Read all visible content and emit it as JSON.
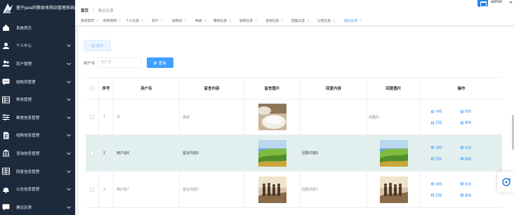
{
  "app": {
    "title": "基于java的粮食收购站管理系统的",
    "user": "admin"
  },
  "sidebar": {
    "items": [
      {
        "label": "系统首页",
        "icon": "home-icon",
        "has_children": false
      },
      {
        "label": "个人中心",
        "icon": "user-icon",
        "has_children": true
      },
      {
        "label": "农户管理",
        "icon": "users-icon",
        "has_children": true
      },
      {
        "label": "收购员管理",
        "icon": "chat-icon",
        "has_children": true
      },
      {
        "label": "种类管理",
        "icon": "grid-icon",
        "has_children": true
      },
      {
        "label": "粮食信息管理",
        "icon": "sliders-icon",
        "has_children": true
      },
      {
        "label": "收购信息管理",
        "icon": "document-icon",
        "has_children": true
      },
      {
        "label": "咨询信息管理",
        "icon": "bank-icon",
        "has_children": true
      },
      {
        "label": "回复信息管理",
        "icon": "grid-icon",
        "has_children": true
      },
      {
        "label": "公告信息管理",
        "icon": "bell-icon",
        "has_children": true
      },
      {
        "label": "建议反馈",
        "icon": "message-icon",
        "has_children": true
      }
    ]
  },
  "breadcrumb": {
    "home": "首页",
    "current": "建议反馈"
  },
  "tags": [
    {
      "label": "系统首页",
      "active": false
    },
    {
      "label": "修改密码",
      "active": false
    },
    {
      "label": "个人信息",
      "active": false
    },
    {
      "label": "农户",
      "active": false
    },
    {
      "label": "收购员",
      "active": false
    },
    {
      "label": "种类",
      "active": false
    },
    {
      "label": "粮食信息",
      "active": false
    },
    {
      "label": "收购信息",
      "active": false
    },
    {
      "label": "咨询信息",
      "active": false
    },
    {
      "label": "回复信息",
      "active": false
    },
    {
      "label": "公告信息",
      "active": false
    },
    {
      "label": "建议反馈",
      "active": true
    }
  ],
  "toolbar": {
    "delete_label": "删除",
    "search_label": "用户名",
    "search_placeholder": "用户名",
    "search_button": "查询"
  },
  "table": {
    "headers": [
      "序号",
      "用户名",
      "留言内容",
      "留言图片",
      "回复内容",
      "回复图片",
      "操作"
    ],
    "rows": [
      {
        "index": "1",
        "username": "11",
        "content": "测试",
        "image": "rice",
        "reply": "",
        "reply_image": "",
        "no_image_text": "无图片"
      },
      {
        "index": "2",
        "username": "用户名8",
        "content": "留言内容8",
        "image": "hills",
        "reply": "回复内容8",
        "reply_image": "hills"
      },
      {
        "index": "3",
        "username": "用户名7",
        "content": "留言内容7",
        "image": "people",
        "reply": "回复内容7",
        "reply_image": "people"
      }
    ],
    "actions": {
      "detail": "详情",
      "edit": "修改",
      "reply": "回复",
      "delete": "删除"
    }
  },
  "colors": {
    "sidebar_bg": "#1c2a3c",
    "primary": "#409eff",
    "hover_row": "#e2efef"
  }
}
